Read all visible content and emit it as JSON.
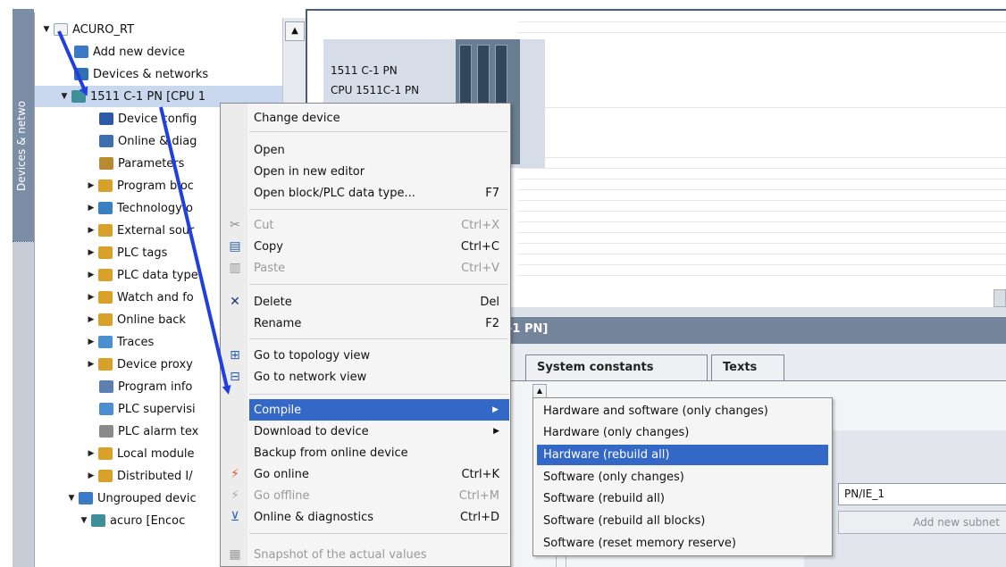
{
  "sidebar": {
    "vertical_tab_label": "Devices & netwo"
  },
  "tree": {
    "items": [
      {
        "label": "ACURO_RT",
        "icon": "project-icon",
        "color": "#e8e8e8"
      },
      {
        "label": "Add new device",
        "icon": "add-device-icon",
        "color": "#3a78c8"
      },
      {
        "label": "Devices & networks",
        "icon": "network-icon",
        "color": "#2f6fb8"
      },
      {
        "label": "1511 C-1 PN [CPU 1",
        "icon": "cpu-icon",
        "color": "#3f8f9a"
      },
      {
        "label": "Device config",
        "icon": "device-config-icon",
        "color": "#2c5aa8"
      },
      {
        "label": "Online & diag",
        "icon": "online-diag-icon",
        "color": "#3a6fb0"
      },
      {
        "label": "Parameters",
        "icon": "parameters-icon",
        "color": "#b88a30"
      },
      {
        "label": "Program bloc",
        "icon": "program-blocks-icon",
        "color": "#d9a02a"
      },
      {
        "label": "Technology o",
        "icon": "technology-icon",
        "color": "#3a7fc0"
      },
      {
        "label": "External sour",
        "icon": "external-source-icon",
        "color": "#d9a02a"
      },
      {
        "label": "PLC tags",
        "icon": "plc-tags-icon",
        "color": "#d9a02a"
      },
      {
        "label": "PLC data type",
        "icon": "plc-data-types-icon",
        "color": "#d9a02a"
      },
      {
        "label": "Watch and fo",
        "icon": "watch-table-icon",
        "color": "#d9a02a"
      },
      {
        "label": "Online back",
        "icon": "online-backup-icon",
        "color": "#d9a02a"
      },
      {
        "label": "Traces",
        "icon": "traces-icon",
        "color": "#4a8fd0"
      },
      {
        "label": "Device proxy",
        "icon": "device-proxy-icon",
        "color": "#d9a02a"
      },
      {
        "label": "Program info",
        "icon": "program-info-icon",
        "color": "#5a7fb0"
      },
      {
        "label": "PLC supervisi",
        "icon": "plc-supervision-icon",
        "color": "#4a8fd0"
      },
      {
        "label": "PLC alarm tex",
        "icon": "plc-alarm-text-icon",
        "color": "#8a8a8a"
      },
      {
        "label": "Local module",
        "icon": "local-modules-icon",
        "color": "#d9a02a"
      },
      {
        "label": "Distributed I/",
        "icon": "distributed-io-icon",
        "color": "#d9a02a"
      },
      {
        "label": "Ungrouped devic",
        "icon": "ungrouped-devices-icon",
        "color": "#3a78c8"
      },
      {
        "label": "acuro [Encoc",
        "icon": "encoder-icon",
        "color": "#3f8f9a"
      }
    ]
  },
  "device": {
    "name": "1511 C-1 PN",
    "type": "CPU 1511C-1 PN"
  },
  "lower_panel": {
    "title": "-1 PN]",
    "tabs": [
      "System constants",
      "Texts"
    ],
    "subnet_value": "PN/IE_1",
    "add_subnet_label": "Add new subnet"
  },
  "context_menu": {
    "items": [
      {
        "label": "Change device",
        "shortcut": "",
        "icon": ""
      },
      {
        "label": "Open",
        "shortcut": "",
        "icon": ""
      },
      {
        "label": "Open in new editor",
        "shortcut": "",
        "icon": ""
      },
      {
        "label": "Open block/PLC data type...",
        "shortcut": "F7",
        "icon": ""
      },
      {
        "label": "Cut",
        "shortcut": "Ctrl+X",
        "icon": "✂"
      },
      {
        "label": "Copy",
        "shortcut": "Ctrl+C",
        "icon": "▤"
      },
      {
        "label": "Paste",
        "shortcut": "Ctrl+V",
        "icon": "▥"
      },
      {
        "label": "Delete",
        "shortcut": "Del",
        "icon": "✕"
      },
      {
        "label": "Rename",
        "shortcut": "F2",
        "icon": ""
      },
      {
        "label": "Go to topology view",
        "shortcut": "",
        "icon": "⊞"
      },
      {
        "label": "Go to network view",
        "shortcut": "",
        "icon": "⊟"
      },
      {
        "label": "Compile",
        "shortcut": "",
        "icon": ""
      },
      {
        "label": "Download to device",
        "shortcut": "",
        "icon": ""
      },
      {
        "label": "Backup from online device",
        "shortcut": "",
        "icon": ""
      },
      {
        "label": "Go online",
        "shortcut": "Ctrl+K",
        "icon": "⚡"
      },
      {
        "label": "Go offline",
        "shortcut": "Ctrl+M",
        "icon": "⚡"
      },
      {
        "label": "Online & diagnostics",
        "shortcut": "Ctrl+D",
        "icon": "⊻"
      },
      {
        "label": "Snapshot of the actual values",
        "shortcut": "",
        "icon": "▦"
      }
    ]
  },
  "compile_submenu": {
    "items": [
      "Hardware and software (only changes)",
      "Hardware (only changes)",
      "Hardware (rebuild all)",
      "Software (only changes)",
      "Software (rebuild all)",
      "Software (rebuild all blocks)",
      "Software (reset memory reserve)"
    ]
  },
  "colors": {
    "highlight": "#3468c7",
    "annotation_arrow": "#1f3fe0",
    "tree_selection": "#c9d8ee"
  }
}
